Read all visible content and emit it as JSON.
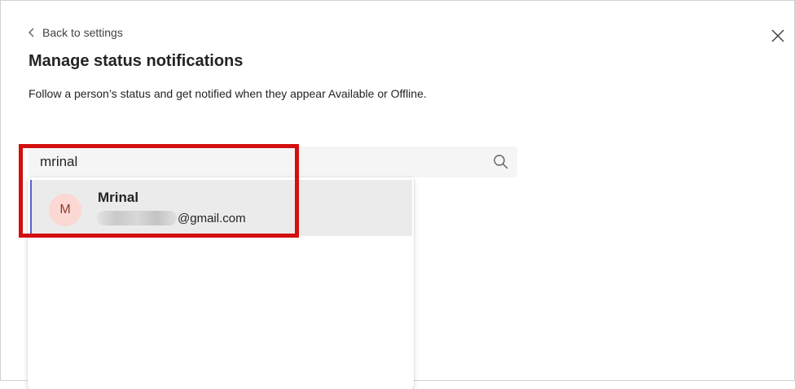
{
  "header": {
    "back_label": "Back to settings",
    "title": "Manage status notifications",
    "description": "Follow a person’s status and get notified when they appear Available or Offline."
  },
  "search": {
    "value": "mrinal",
    "icon": "search-icon"
  },
  "results": [
    {
      "initial": "M",
      "name": "Mrinal",
      "email_domain": "@gmail.com"
    }
  ],
  "colors": {
    "highlight": "#d30e0e",
    "avatar_bg": "#fbd8d3",
    "avatar_text": "#8e3a2f",
    "selected_accent": "#5b5fc7",
    "selected_bg": "#ebebeb"
  },
  "icons": {
    "back": "chevron-left-icon",
    "close": "close-icon"
  }
}
